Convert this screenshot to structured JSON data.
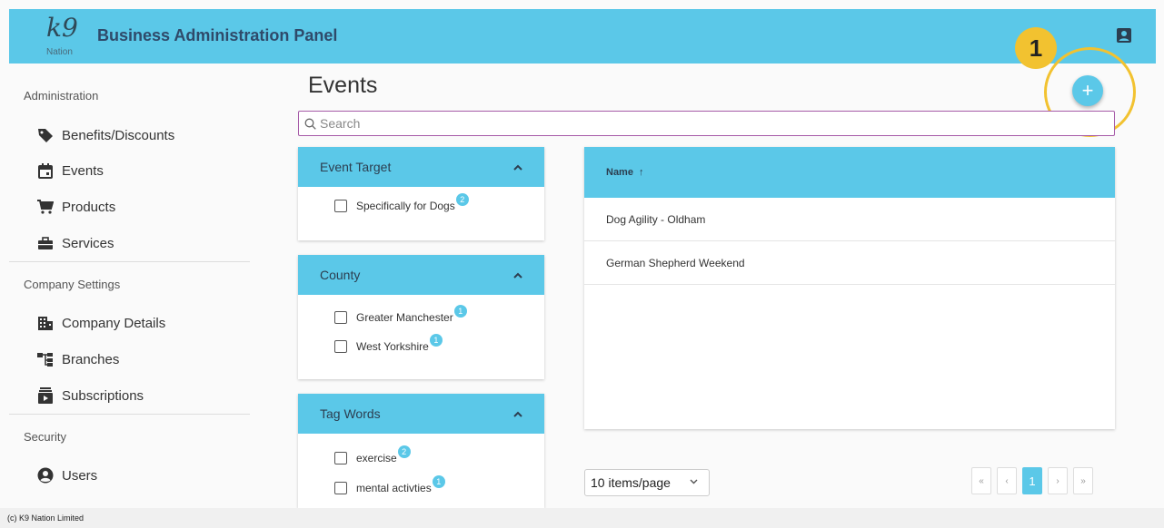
{
  "header": {
    "logo_mark": "k9",
    "logo_text": "Nation",
    "title": "Business Administration Panel",
    "account_icon": "account-box-icon",
    "color": "#5bc8e8"
  },
  "sidebar": {
    "sections": [
      {
        "title": "Administration",
        "items": [
          {
            "label": "Benefits/Discounts",
            "icon": "tag-icon"
          },
          {
            "label": "Events",
            "icon": "calendar-icon"
          },
          {
            "label": "Products",
            "icon": "cart-icon"
          },
          {
            "label": "Services",
            "icon": "briefcase-icon"
          }
        ]
      },
      {
        "title": "Company Settings",
        "items": [
          {
            "label": "Company Details",
            "icon": "building-icon"
          },
          {
            "label": "Branches",
            "icon": "hierarchy-icon"
          },
          {
            "label": "Subscriptions",
            "icon": "subscriptions-icon"
          }
        ]
      },
      {
        "title": "Security",
        "items": [
          {
            "label": "Users",
            "icon": "user-circle-icon"
          }
        ]
      }
    ]
  },
  "main": {
    "title": "Events",
    "add_label": "+",
    "callout_number": "1",
    "search": {
      "placeholder": "Search",
      "value": ""
    },
    "filters": [
      {
        "title": "Event Target",
        "options": [
          {
            "label": "Specifically for Dogs",
            "count": "2"
          }
        ]
      },
      {
        "title": "County",
        "options": [
          {
            "label": "Greater Manchester",
            "count": "1"
          },
          {
            "label": "West Yorkshire",
            "count": "1"
          }
        ]
      },
      {
        "title": "Tag Words",
        "options": [
          {
            "label": "exercise",
            "count": "2"
          },
          {
            "label": "mental activties",
            "count": "1"
          }
        ]
      }
    ],
    "table": {
      "column": "Name",
      "sort_glyph": "↑",
      "rows": [
        "Dog Agility - Oldham",
        "German Shepherd Weekend"
      ]
    },
    "pagination": {
      "per_page": "10 items/page",
      "first": "«",
      "prev": "‹",
      "current": "1",
      "next": "›",
      "last": "»"
    }
  },
  "footer": {
    "text": "(c) K9 Nation Limited"
  }
}
